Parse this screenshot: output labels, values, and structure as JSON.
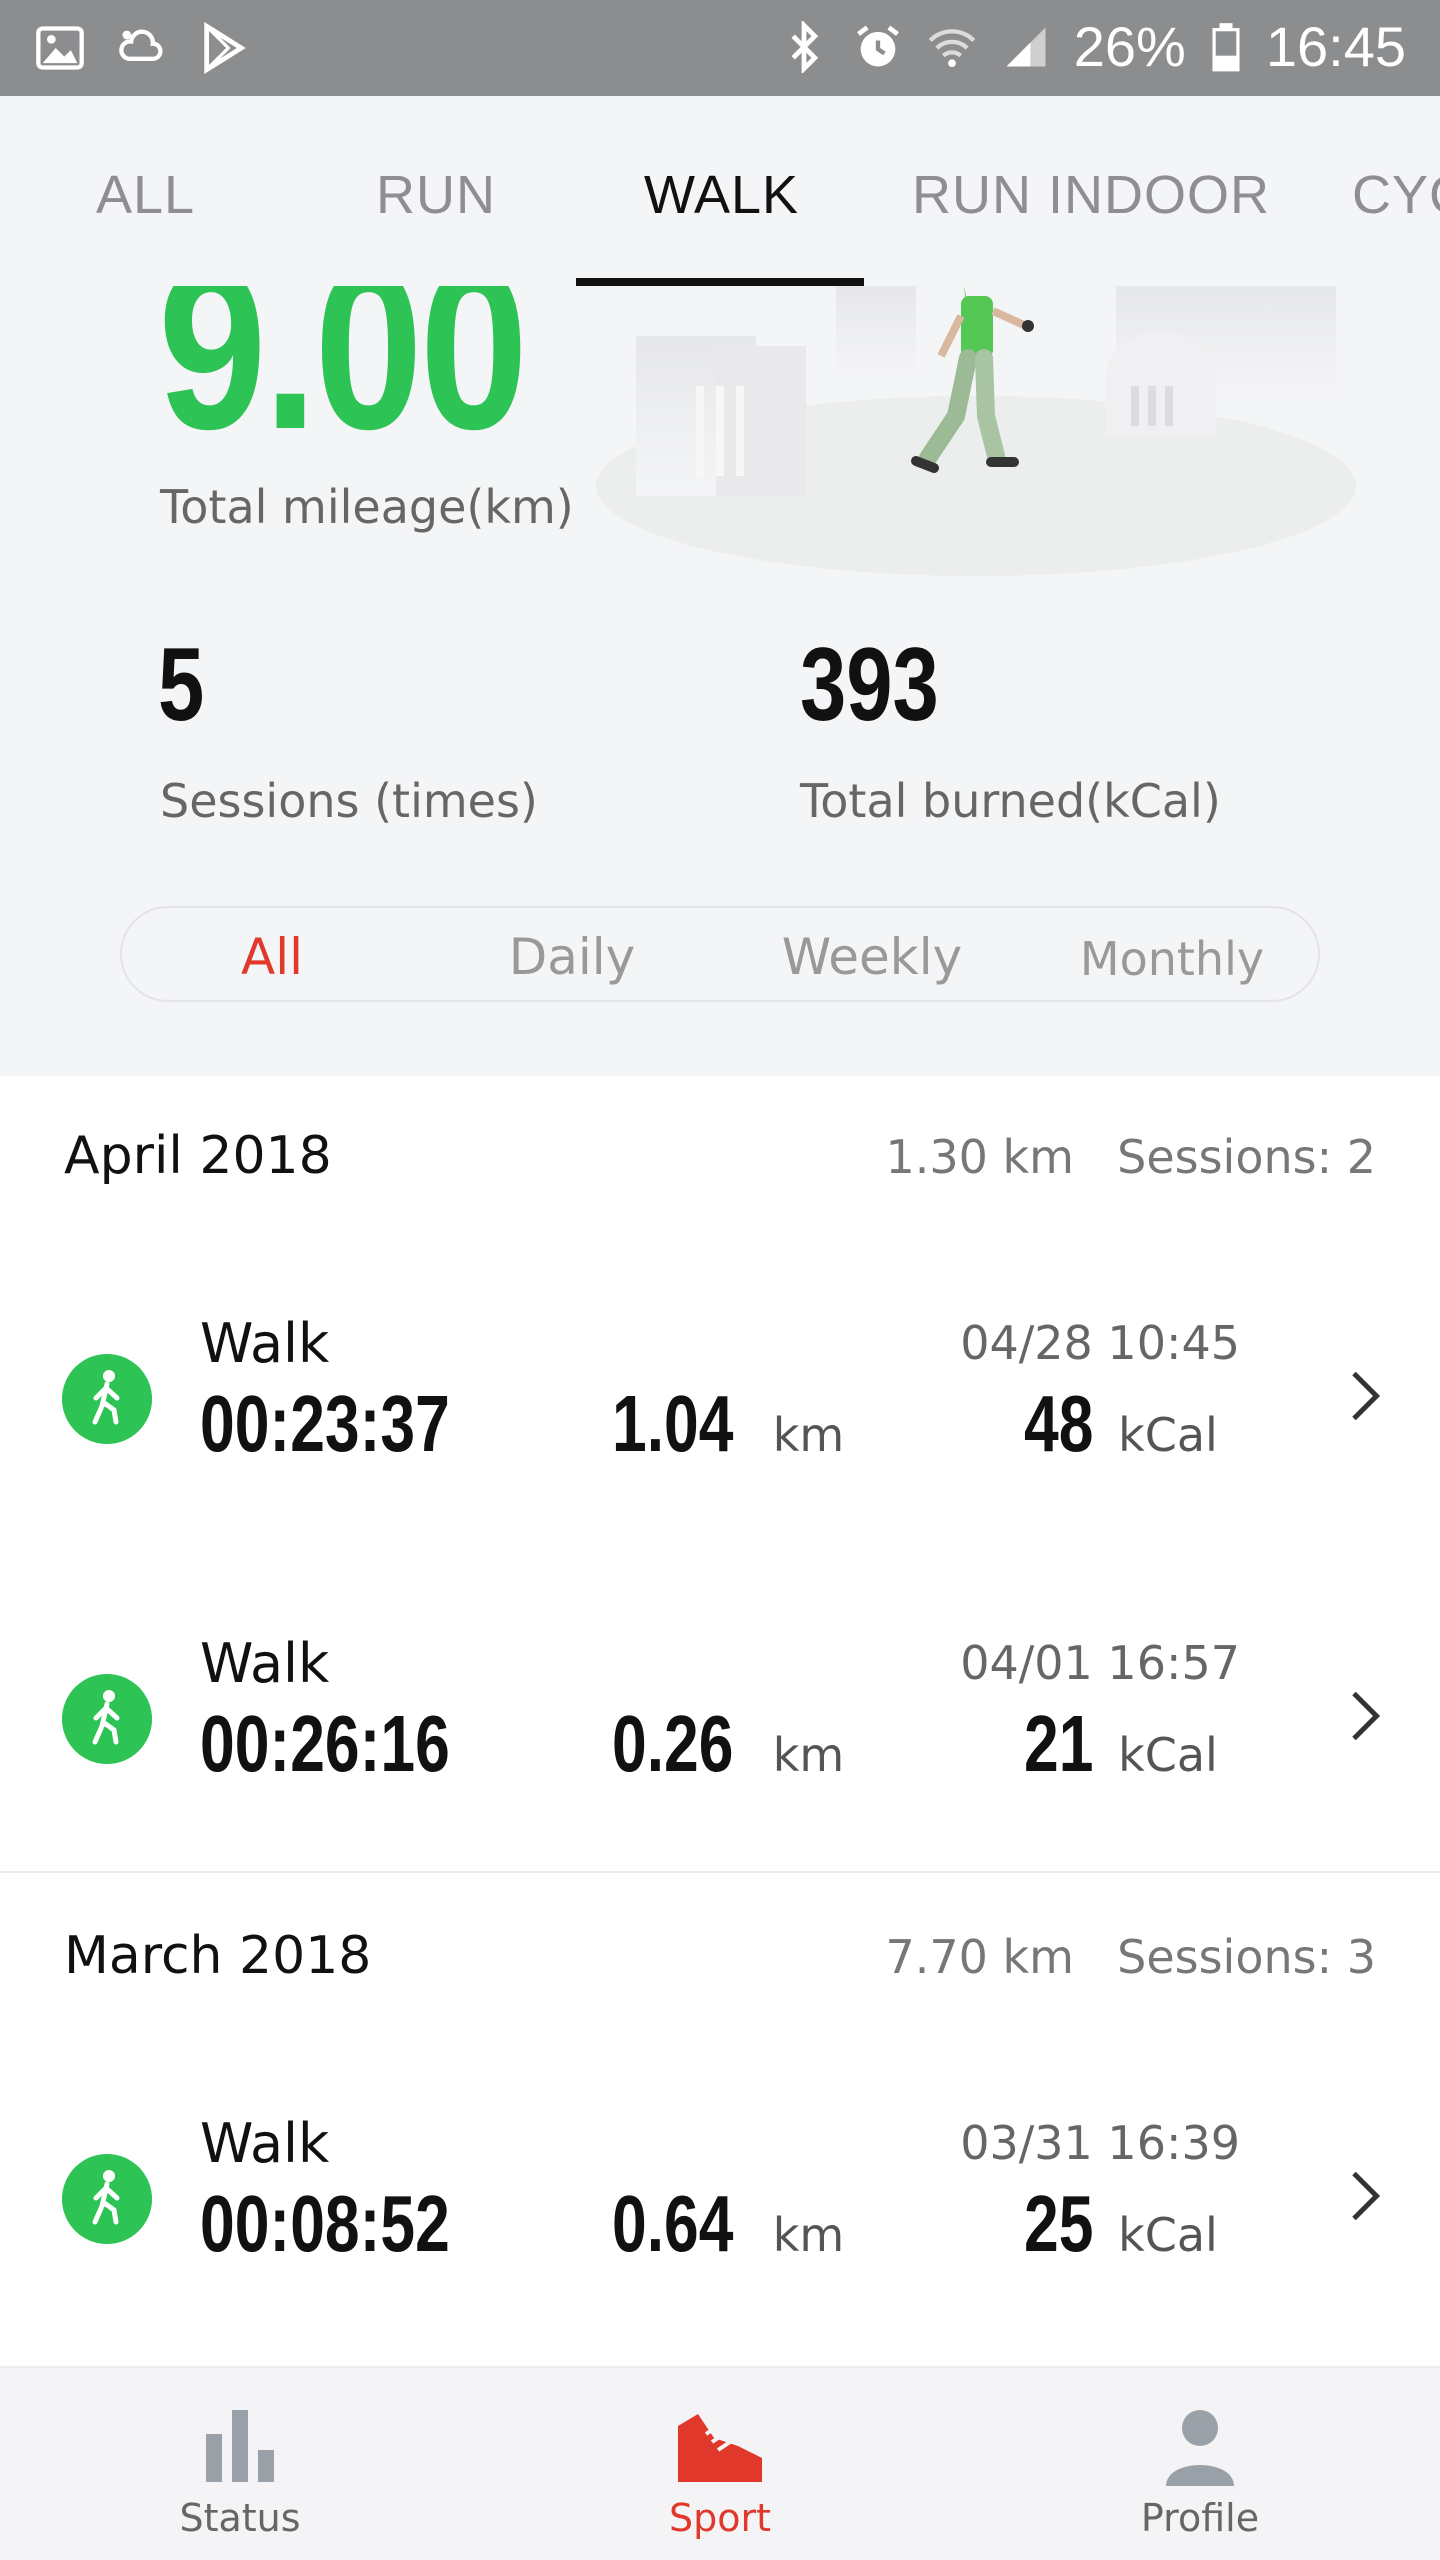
{
  "status_bar": {
    "battery": "26%",
    "time": "16:45"
  },
  "tabs": [
    {
      "label": "ALL"
    },
    {
      "label": "RUN"
    },
    {
      "label": "WALK"
    },
    {
      "label": "RUN INDOOR"
    },
    {
      "label": "CYC"
    }
  ],
  "summary": {
    "total_mileage_value": "9.00",
    "total_mileage_label": "Total mileage(km)",
    "sessions_value": "5",
    "sessions_label": "Sessions (times)",
    "burned_value": "393",
    "burned_label": "Total burned(kCal)"
  },
  "filter": {
    "options": [
      "All",
      "Daily",
      "Weekly",
      "Monthly"
    ],
    "selected": "All"
  },
  "months": [
    {
      "title": "April 2018",
      "km": "1.30 km",
      "sessions": "Sessions: 2",
      "entries": [
        {
          "type": "Walk",
          "date": "04/28  10:45",
          "duration": "00:23:37",
          "distance": "1.04",
          "distance_unit": "km",
          "calories": "48",
          "calories_unit": "kCal"
        },
        {
          "type": "Walk",
          "date": "04/01  16:57",
          "duration": "00:26:16",
          "distance": "0.26",
          "distance_unit": "km",
          "calories": "21",
          "calories_unit": "kCal"
        }
      ]
    },
    {
      "title": "March 2018",
      "km": "7.70 km",
      "sessions": "Sessions: 3",
      "entries": [
        {
          "type": "Walk",
          "date": "03/31  16:39",
          "duration": "00:08:52",
          "distance": "0.64",
          "distance_unit": "km",
          "calories": "25",
          "calories_unit": "kCal"
        }
      ]
    }
  ],
  "bottom_nav": [
    {
      "label": "Status",
      "icon": "bar-chart-icon"
    },
    {
      "label": "Sport",
      "icon": "shoe-icon",
      "active": true
    },
    {
      "label": "Profile",
      "icon": "person-icon"
    }
  ],
  "colors": {
    "accent_green": "#2ec455",
    "accent_red": "#e0392b"
  }
}
